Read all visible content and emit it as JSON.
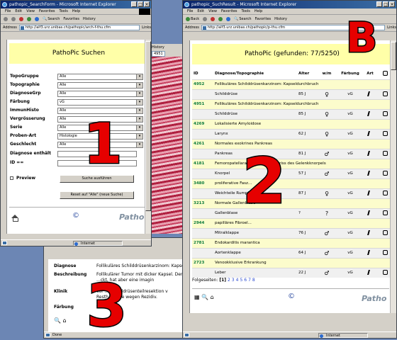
{
  "search_window": {
    "title": "pathopic_SearchForm - Microsoft Internet Explorer",
    "menu": [
      "File",
      "Edit",
      "View",
      "Favorites",
      "Tools",
      "Help"
    ],
    "toolbar": {
      "back": "Back",
      "search": "Search",
      "favorites": "Favorites",
      "history": "History"
    },
    "address_label": "Address",
    "address_url": "http://alf3.urz.unibas.ch/pathopic/arch-f-thu.cfm",
    "links_label": "Links",
    "banner": "PathoPic  Suchen",
    "fields": [
      {
        "label": "TopoGruppe",
        "value": "Alle"
      },
      {
        "label": "Topographie",
        "value": "Alle"
      },
      {
        "label": "DiagnoseGrp",
        "value": "Alle"
      },
      {
        "label": "Färbung",
        "value": "vG"
      },
      {
        "label": "ImmunHisto",
        "value": "Alle"
      },
      {
        "label": "Vergrösserung",
        "value": "Alle"
      },
      {
        "label": "Serie",
        "value": "Alle"
      },
      {
        "label": "Proben-Art",
        "value": "Histologie"
      },
      {
        "label": "Geschlecht",
        "value": "Alle"
      }
    ],
    "diagnose_label": "Diagnose enthält",
    "id_label": "ID   ==",
    "preview_label": "Preview",
    "submit_button": "Suche ausführen",
    "reset_button": "Reset auf \"Alle\" (neue Suche)",
    "copyright": "©",
    "brand": "Patho",
    "status_zone": "Internet"
  },
  "results_window": {
    "title": "pathopic_SuchResult - Microsoft Internet Explorer",
    "menu": [
      "File",
      "Edit",
      "View",
      "Favorites",
      "Tools",
      "Help"
    ],
    "address_label": "Address",
    "address_url": "http://alf3.urz.unibas.ch/pathopic/p-thu.cfm",
    "toolbar": {
      "back": "Back",
      "search": "Search",
      "favorites": "Favorites",
      "history": "History"
    },
    "links_label": "Links",
    "banner": "PathoPic   (gefunden: 77/5250)",
    "columns": [
      "ID",
      "Diagnose/Topographie",
      "Alter",
      "w/m",
      "Färbung",
      "Art"
    ],
    "rows": [
      {
        "id": "4952",
        "diagnosis": "Follikuläres Schilddrüsenkarzinom: Kapseldurchbruch",
        "organ": "Schilddrüse",
        "age": "85 J",
        "sex": "♀",
        "stain": "vG"
      },
      {
        "id": "4951",
        "diagnosis": "Follikuläres Schilddrüsenkarzinom: Kapseldurchbruch",
        "organ": "Schilddrüse",
        "age": "85 J",
        "sex": "♀",
        "stain": "vG"
      },
      {
        "id": "4269",
        "diagnosis": "Lokalisierte Amyloidose",
        "organ": "Larynx",
        "age": "62 J",
        "sex": "♀",
        "stain": "vG"
      },
      {
        "id": "4261",
        "diagnosis": "Normales exokrines Pankreas",
        "organ": "Pankreas",
        "age": "81 J",
        "sex": "♂",
        "stain": "vG"
      },
      {
        "id": "4181",
        "diagnosis": "Femoropatellararthrose: alter Einriss des Gelenkknorpels",
        "organ": "Knorpel",
        "age": "57 J",
        "sex": "♂",
        "stain": "vG"
      },
      {
        "id": "3480",
        "diagnosis": "proliferative Fasz...",
        "organ": "Weichteile Rumpf",
        "age": "87 J",
        "sex": "♀",
        "stain": "vG"
      },
      {
        "id": "3213",
        "diagnosis": "Normale Gallenblase",
        "organ": "Gallenblase",
        "age": "?",
        "sex": "?",
        "stain": "vG"
      },
      {
        "id": "2944",
        "diagnosis": "papilläres Fibroel...",
        "organ": "Mitralklappe",
        "age": "76 J",
        "sex": "♂",
        "stain": "vG"
      },
      {
        "id": "2781",
        "diagnosis": "Endokarditis marantica",
        "organ": "Aortenklappe",
        "age": "64 J",
        "sex": "♂",
        "stain": "vG"
      },
      {
        "id": "2723",
        "diagnosis": "Venookklusive Erkrankung",
        "organ": "Leber",
        "age": "22 J",
        "sex": "♂",
        "stain": "vG"
      }
    ],
    "pager_label": "Folgeseiten:",
    "pager_current": "[1]",
    "pager_pages": [
      "2",
      "3",
      "4",
      "5",
      "6",
      "7",
      "8"
    ],
    "copyright": "©",
    "brand": "Patho",
    "status_zone": "Internet"
  },
  "detail_window": {
    "diagnose_label": "Diagnose",
    "diagnose_value": "Follikuläres Schilddrüsenkarzinom: Kapsel",
    "beschreibung_label": "Beschreibung",
    "beschreibung_value": [
      "Follikulärer Tumor mit dicker Kapsel. Der T",
      "...ckt, hat aber eine imagin",
      ""
    ],
    "klinik_label": "Klinik",
    "klinik_value": [
      "Vor ... Schilddrüsenteilresektion v",
      "Resth... omie wegen Rezidiv."
    ],
    "faerbung_label": "Färbung",
    "faerbung_value": "vG",
    "copyright": "©",
    "status_done": "Done"
  },
  "tissue_window": {
    "history_label": "History",
    "field_value": "4951"
  },
  "callouts": {
    "one": "1",
    "two": "2",
    "three": "3",
    "b": "B"
  }
}
